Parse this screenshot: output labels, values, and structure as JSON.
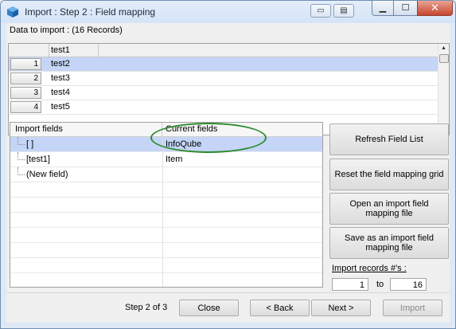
{
  "window": {
    "title": "Import : Step 2 : Field mapping",
    "close_glyph": "✕",
    "minimize_glyph": "▁",
    "maximize_glyph": "☐"
  },
  "data_header": "Data to import : (16 Records)",
  "grid": {
    "column": "test1",
    "rows": [
      {
        "num": "1",
        "value": "test2"
      },
      {
        "num": "2",
        "value": "test3"
      },
      {
        "num": "3",
        "value": "test4"
      },
      {
        "num": "4",
        "value": "test5"
      }
    ]
  },
  "mapping": {
    "col_import": "Import fields",
    "col_current": "Current fields",
    "rows": [
      {
        "import": "[ ]",
        "current": "InfoQube"
      },
      {
        "import": "[test1]",
        "current": "Item"
      },
      {
        "import": "(New field)",
        "current": ""
      }
    ]
  },
  "buttons": {
    "refresh": "Refresh Field List",
    "reset": "Reset the field mapping grid",
    "open": "Open an import field mapping file",
    "save": "Save as an import field mapping file",
    "close": "Close",
    "back": "< Back",
    "next": "Next >",
    "import": "Import"
  },
  "import_records": {
    "label": "Import records #'s :",
    "from": "1",
    "to_label": "to",
    "to": "16"
  },
  "step_text": "Step 2 of 3",
  "colors": {
    "selection": "#c4d5f7",
    "highlight_ellipse": "#2c8a2c"
  }
}
